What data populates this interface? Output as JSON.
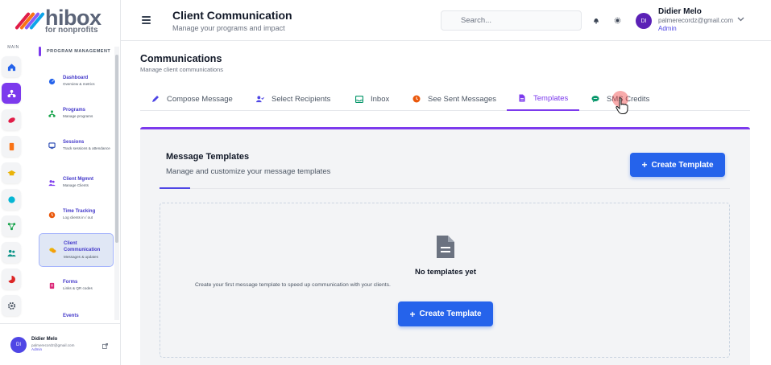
{
  "brand": {
    "name": "hibox",
    "tagline": "for nonprofits"
  },
  "rail": {
    "label": "MAIN",
    "icons": [
      "home-icon",
      "program-icon",
      "sessions-icon",
      "reports-icon",
      "training-icon",
      "globe-icon",
      "network-icon",
      "people-icon",
      "analytics-icon",
      "settings-icon"
    ]
  },
  "sidebar": {
    "section_title": "PROGRAM MANAGEMENT",
    "items": [
      {
        "title": "Dashboard",
        "subtitle": "Overview & metrics",
        "icon": "dashboard-icon"
      },
      {
        "title": "Programs",
        "subtitle": "Manage programs",
        "icon": "programs-icon"
      },
      {
        "title": "Sessions",
        "subtitle": "Track sessions & attendance",
        "icon": "sessions-icon"
      },
      {
        "title": "Client Mgmnt",
        "subtitle": "Manage Clients",
        "icon": "clients-icon"
      },
      {
        "title": "Time Tracking",
        "subtitle": "Log clients in / out",
        "icon": "clock-icon"
      },
      {
        "title": "Client Communication",
        "subtitle": "Messages & updates",
        "icon": "chat-icon"
      },
      {
        "title": "Forms",
        "subtitle": "Links & QR codes",
        "icon": "forms-icon"
      },
      {
        "title": "Events",
        "subtitle": "",
        "icon": "events-icon"
      }
    ],
    "active_index": 5
  },
  "sidebar_user": {
    "initials": "DI",
    "name": "Didier Melo",
    "email": "palmerecordz@gmail.com",
    "role": "Admin"
  },
  "header": {
    "title": "Client Communication",
    "subtitle": "Manage your programs and impact",
    "search_placeholder": "Search...",
    "user": {
      "initials": "DI",
      "name": "Didier Melo",
      "email": "palmerecordz@gmail.com",
      "role": "Admin"
    }
  },
  "page": {
    "title": "Communications",
    "subtitle": "Manage client communications",
    "tabs": [
      {
        "label": "Compose Message",
        "icon": "pencil-icon"
      },
      {
        "label": "Select Recipients",
        "icon": "user-check-icon"
      },
      {
        "label": "Inbox",
        "icon": "inbox-icon"
      },
      {
        "label": "See Sent Messages",
        "icon": "history-icon"
      },
      {
        "label": "Templates",
        "icon": "document-icon"
      },
      {
        "label": "SMS Credits",
        "icon": "sms-icon"
      }
    ],
    "active_tab": "Templates"
  },
  "templates": {
    "title": "Message Templates",
    "subtitle": "Manage and customize your message templates",
    "create_label": "Create Template",
    "empty_title": "No templates yet",
    "empty_subtitle": "Create your first message template to speed up communication with your clients.",
    "empty_create_label": "Create Template"
  },
  "colors": {
    "accent": "#7c3aed",
    "primary_button": "#2563eb",
    "link": "#4f46e5"
  }
}
